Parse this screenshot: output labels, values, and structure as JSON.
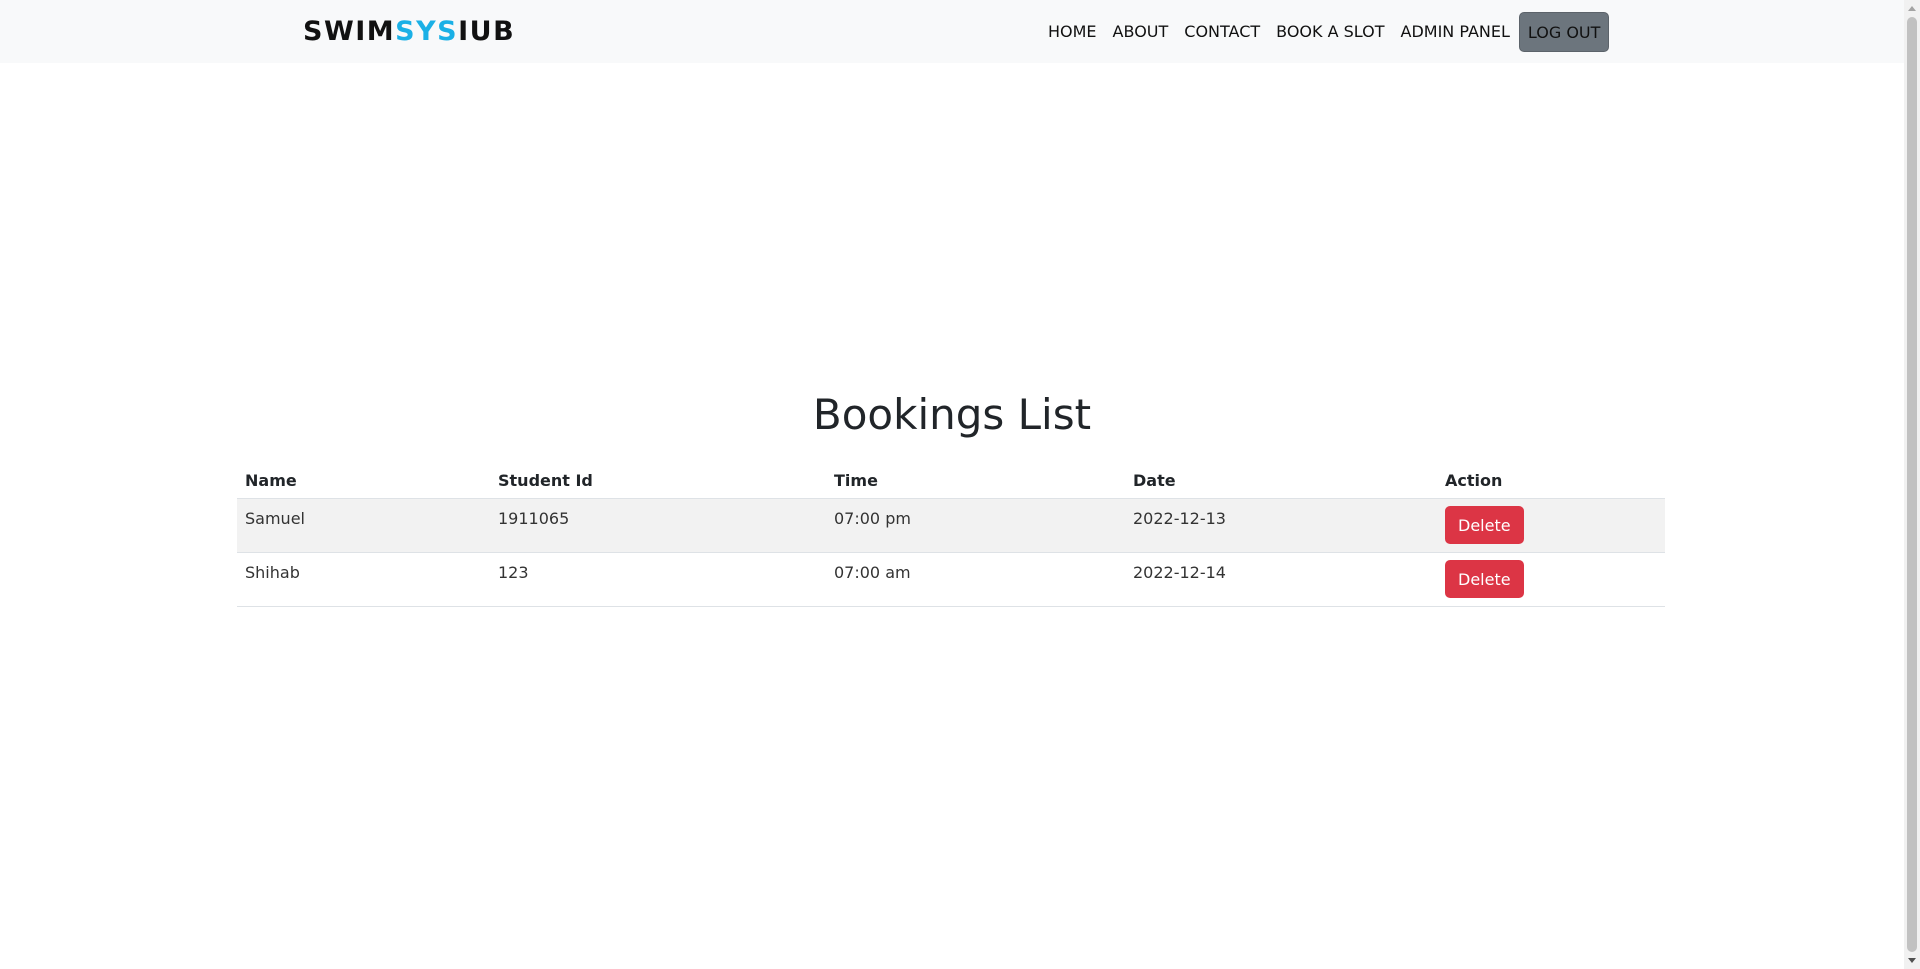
{
  "navbar": {
    "brand": {
      "part1": "SWIM",
      "part2": "SYS",
      "part3": "IUB",
      "accent_color": "#1ab0e6"
    },
    "links": [
      {
        "label": "HOME"
      },
      {
        "label": "ABOUT"
      },
      {
        "label": "CONTACT"
      },
      {
        "label": "BOOK A SLOT"
      },
      {
        "label": "ADMIN PANEL"
      }
    ],
    "logout_label": "LOG OUT"
  },
  "main": {
    "title": "Bookings List",
    "table": {
      "headers": [
        "Name",
        "Student Id",
        "Time",
        "Date",
        "Action"
      ],
      "rows": [
        {
          "name": "Samuel",
          "student_id": "1911065",
          "time": "07:00 pm",
          "date": "2022-12-13",
          "action_label": "Delete"
        },
        {
          "name": "Shihab",
          "student_id": "123",
          "time": "07:00 am",
          "date": "2022-12-14",
          "action_label": "Delete"
        }
      ]
    }
  },
  "colors": {
    "navbar_bg": "#f8f9fa",
    "delete_button": "#dc3545",
    "logout_button": "#6c757d"
  }
}
